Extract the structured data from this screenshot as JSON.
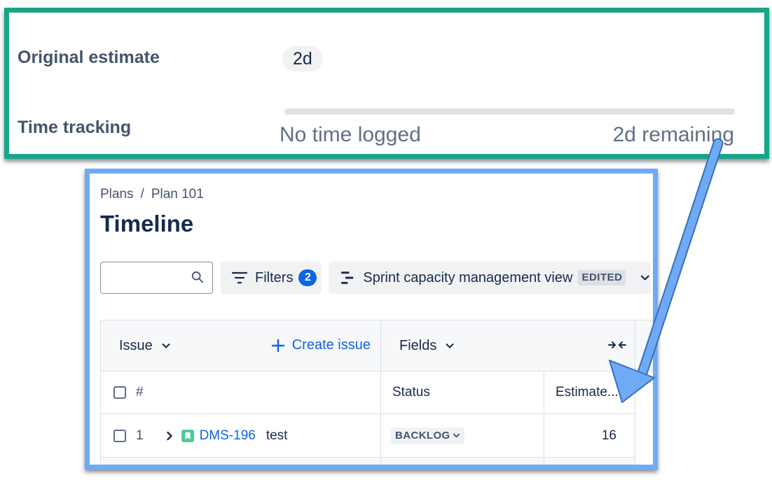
{
  "details": {
    "original_estimate_label": "Original estimate",
    "original_estimate_value": "2d",
    "time_tracking_label": "Time tracking",
    "time_logged_text": "No time logged",
    "time_remaining_text": "2d remaining",
    "time_logged_fraction": 0
  },
  "plan": {
    "breadcrumb": [
      "Plans",
      "Plan 101"
    ],
    "breadcrumb_separator": "/",
    "title": "Timeline",
    "search": {
      "placeholder": "",
      "value": ""
    },
    "filters": {
      "label": "Filters",
      "count": "2"
    },
    "view": {
      "label": "Sprint capacity management view",
      "badge": "EDITED"
    },
    "table": {
      "issue_header": "Issue",
      "create_issue_label": "Create issue",
      "fields_header": "Fields",
      "number_header": "#",
      "status_header": "Status",
      "estimate_header": "Estimate...",
      "rows": [
        {
          "number": "1",
          "key": "DMS-196",
          "summary": "test",
          "status": "BACKLOG",
          "estimate": "16"
        }
      ]
    }
  },
  "colors": {
    "details_frame": "#17a589",
    "plan_frame": "#6faaf7",
    "arrow": "#6faaf7",
    "link": "#0c66e4",
    "story_icon": "#4bce97"
  },
  "icons": {
    "search": "search-icon",
    "filters": "filter-icon",
    "view": "view-icon",
    "dropdown": "chevron-down-icon",
    "create": "plus-icon",
    "collapse": "collapse-columns-icon",
    "expand": "chevron-right-icon",
    "issue_type": "story-icon"
  }
}
